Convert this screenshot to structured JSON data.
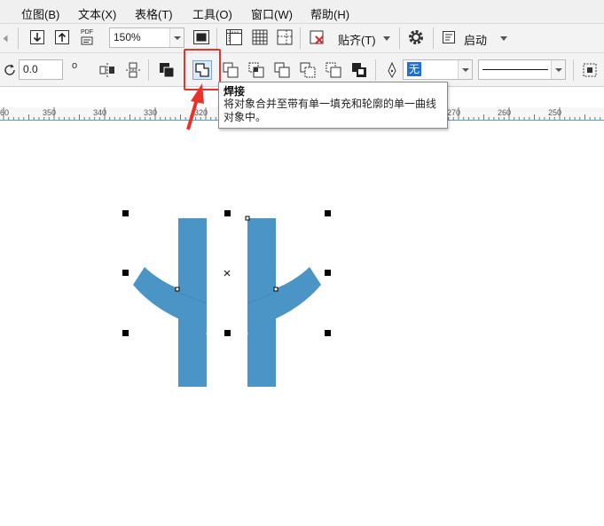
{
  "menu": {
    "items": [
      {
        "label": "位图(B)"
      },
      {
        "label": "文本(X)"
      },
      {
        "label": "表格(T)"
      },
      {
        "label": "工具(O)"
      },
      {
        "label": "窗口(W)"
      },
      {
        "label": "帮助(H)"
      }
    ]
  },
  "toolbar_standard": {
    "pdf_label": "PDF",
    "zoom_value": "150%",
    "snap_label": "贴齐(T)",
    "launch_label": "启动"
  },
  "toolbar_property": {
    "rotation_value": "0.0",
    "rotation_unit": "o",
    "fill_value": "无"
  },
  "ruler": {
    "labels": [
      "60",
      "350",
      "340",
      "330",
      "320",
      "270",
      "260",
      "250"
    ]
  },
  "tooltip": {
    "title": "焊接",
    "description": "将对象合并至带有单一填充和轮廓的单一曲线对象中。"
  },
  "colors": {
    "shape_fill": "#4a94c6",
    "highlight": "#e8332d",
    "arrow": "#e8332d"
  }
}
